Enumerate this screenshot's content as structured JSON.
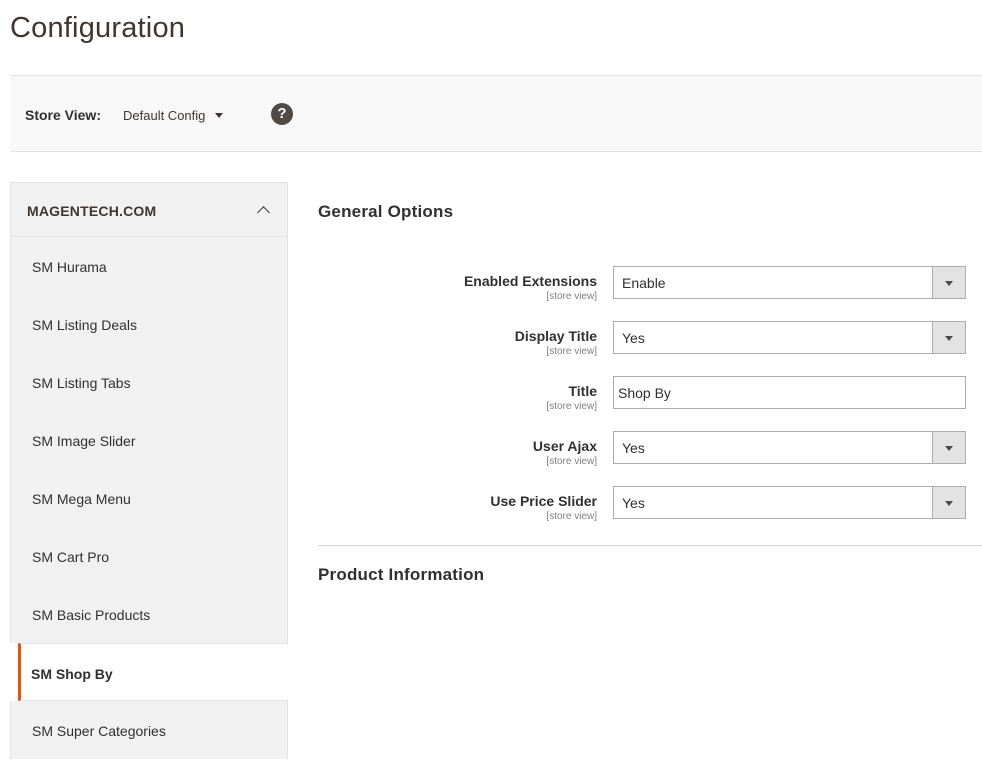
{
  "page": {
    "title": "Configuration"
  },
  "store_bar": {
    "label": "Store View:",
    "value": "Default Config",
    "help": "?"
  },
  "sidebar": {
    "heading": "MAGENTECH.COM",
    "items": [
      {
        "label": "SM Hurama"
      },
      {
        "label": "SM Listing Deals"
      },
      {
        "label": "SM Listing Tabs"
      },
      {
        "label": "SM Image Slider"
      },
      {
        "label": "SM Mega Menu"
      },
      {
        "label": "SM Cart Pro"
      },
      {
        "label": "SM Basic Products"
      },
      {
        "label": "SM Shop By",
        "active": true
      },
      {
        "label": "SM Super Categories"
      }
    ]
  },
  "main": {
    "general_title": "General Options",
    "product_title": "Product Information",
    "scope": "[store view]",
    "fields": [
      {
        "label": "Enabled Extensions",
        "value": "Enable",
        "type": "select"
      },
      {
        "label": "Display Title",
        "value": "Yes",
        "type": "select"
      },
      {
        "label": "Title",
        "value": "Shop By",
        "type": "text"
      },
      {
        "label": "User Ajax",
        "value": "Yes",
        "type": "select"
      },
      {
        "label": "Use Price Slider",
        "value": "Yes",
        "type": "select"
      }
    ]
  },
  "colors": {
    "accent": "#eb5202",
    "title": "#41362f"
  }
}
